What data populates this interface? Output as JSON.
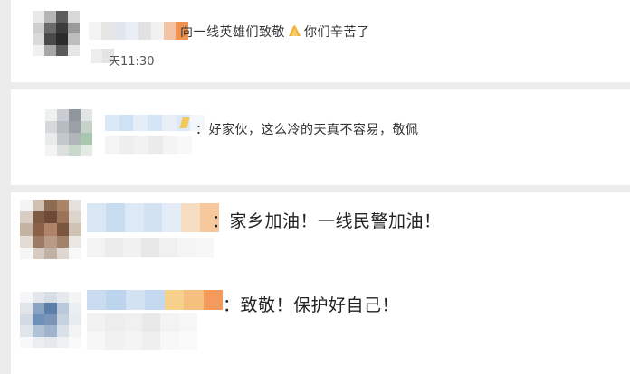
{
  "comments": [
    {
      "text_before": "向一线英雄们致敬",
      "emoji": "clapping-hands",
      "text_after": "你们辛苦了",
      "time": "天11:30"
    },
    {
      "text": "：好家伙，这么冷的天真不容易，敬佩"
    },
    {
      "text": "：家乡加油！一线民警加油！"
    },
    {
      "text": "：致敬！保护好自己！"
    }
  ],
  "colors": {
    "page_background": "#ececec",
    "card_background": "#ffffff",
    "text": "#333333",
    "pixelation_light_blue": "#cfe1f4",
    "pixelation_orange": "#f39a5c",
    "pixelation_yellow": "#f7d08c"
  }
}
